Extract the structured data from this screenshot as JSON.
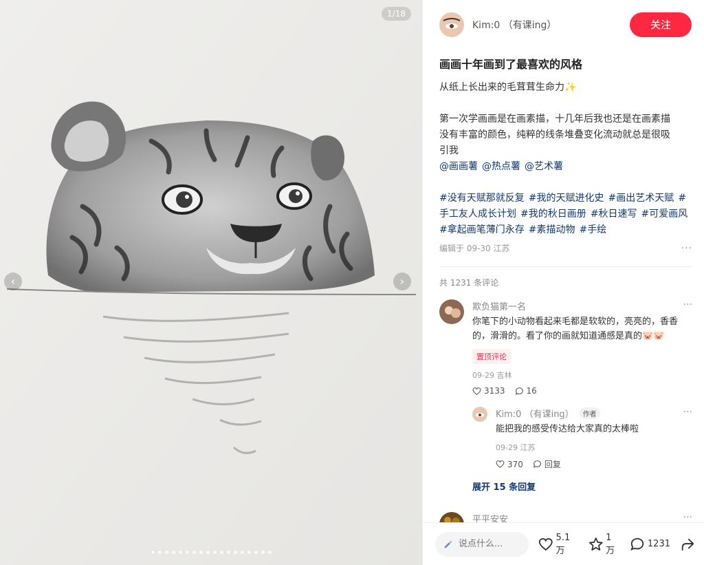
{
  "media": {
    "counter": "1/18",
    "slide_count": 18,
    "active_index": 0
  },
  "author": {
    "name": "Kim:0 （有课ing）",
    "follow_label": "关注"
  },
  "post": {
    "title": "画画十年画到了最喜欢的风格",
    "lines": [
      "从纸上长出来的毛茸茸生命力✨",
      "",
      "第一次学画画是在画素描，十几年后我也还是在画素描",
      "没有丰富的颜色，纯粹的线条堆叠变化流动就总是很吸",
      "引我"
    ],
    "mentions": [
      "@画画薯",
      "@热点薯",
      "@艺术薯"
    ],
    "tags": [
      "#没有天赋那就反复",
      "#我的天赋进化史",
      "#画出艺术天赋",
      "#手工友人成长计划",
      "#我的秋日画册",
      "#秋日速写",
      "#可爱画风",
      "#拿起画笔薄门永存",
      "#素描动物",
      "#手绘"
    ],
    "edited": "编辑于 09-30 江苏"
  },
  "comments": {
    "total": "共 1231 条评论",
    "items": [
      {
        "name": "欺负猫第一名",
        "text": "你笔下的小动物看起来毛都是软软的，亮亮的，香香的，滑滑的。看了你的画就知道通感是真的🐷🐷",
        "pin_label": "置顶评论",
        "meta": "09-29 吉林",
        "likes": "3133",
        "replies": "16",
        "reply": {
          "name": "Kim:0 （有课ing）",
          "author_label": "作者",
          "text": "能把我的感受传达给大家真的太棒啦",
          "meta": "09-29 江苏",
          "likes": "370",
          "reply_label": "回复"
        },
        "expand_label": "展开 15 条回复"
      },
      {
        "name": "平平安安"
      }
    ]
  },
  "bottom_bar": {
    "input_placeholder": "说点什么...",
    "likes": "5.1万",
    "collects": "1万",
    "comments": "1231"
  },
  "icons": {
    "pencil": "pencil-icon",
    "heart": "heart-icon",
    "star": "star-icon",
    "comment": "comment-icon",
    "share": "share-icon"
  },
  "colors": {
    "accent": "#ff2741",
    "link": "#13386c"
  }
}
